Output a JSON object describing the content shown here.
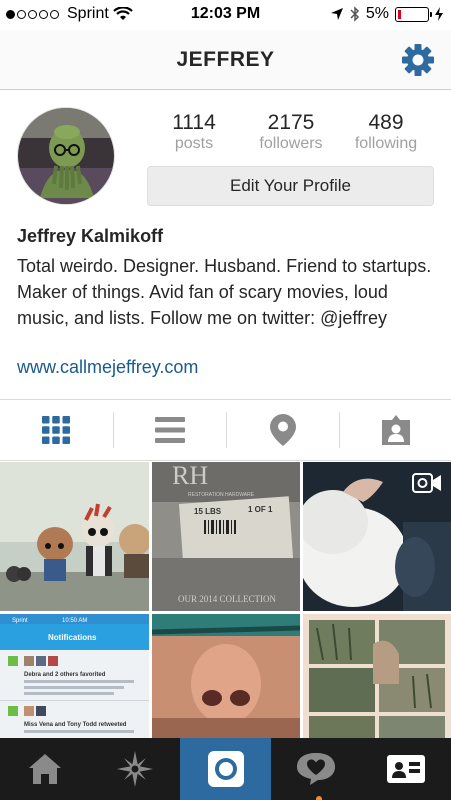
{
  "status_bar": {
    "carrier": "Sprint",
    "time": "12:03 PM",
    "battery": "5%"
  },
  "header": {
    "title": "JEFFREY",
    "settings_icon": "gear-icon"
  },
  "profile": {
    "stats": [
      {
        "value": "1114",
        "label": "posts"
      },
      {
        "value": "2175",
        "label": "followers"
      },
      {
        "value": "489",
        "label": "following"
      }
    ],
    "edit_label": "Edit Your Profile",
    "name": "Jeffrey Kalmikoff",
    "bio": "Total weirdo. Designer. Husband. Friend to startups. Maker of things. Avid fan of scary movies, loud music, and lists. Follow me on twitter: @jeffrey",
    "website": "www.callmejeffrey.com"
  },
  "view_tabs": [
    "grid-icon",
    "list-icon",
    "map-pin-icon",
    "tagged-photos-icon"
  ],
  "photos": [
    {
      "name": "photo-funko-figures"
    },
    {
      "name": "photo-restoration-hardware-box",
      "texts": [
        "RH",
        "RESTORATION HARDWARE",
        "15 LBS",
        "1 OF 1",
        "OUR 2014 COLLECTION"
      ]
    },
    {
      "name": "photo-cat-hand",
      "video": true
    },
    {
      "name": "photo-notifications-screenshot",
      "texts": [
        "Sprint",
        "10:50 AM",
        "Notifications",
        "Debra and 2 others favorited",
        "Miss Vena and Tony Todd retweeted"
      ]
    },
    {
      "name": "photo-face-closeup"
    },
    {
      "name": "photo-tree-collage"
    }
  ],
  "tab_bar": [
    "home-icon",
    "explore-icon",
    "camera-icon",
    "activity-icon",
    "profile-icon"
  ],
  "colors": {
    "accent": "#2d6aa0",
    "link": "#1a5a8e",
    "battery_low": "#d9001b"
  }
}
